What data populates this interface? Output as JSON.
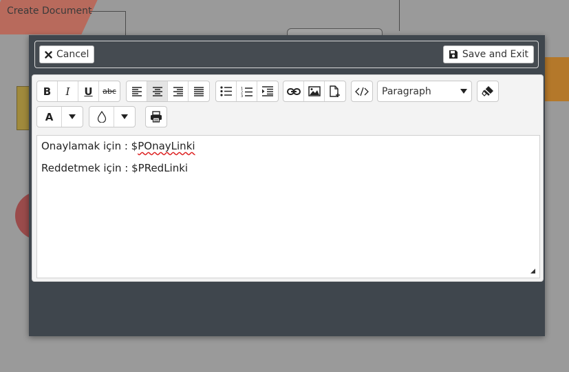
{
  "background": {
    "label": "Create Document"
  },
  "topbar": {
    "cancel_label": "Cancel",
    "save_label": "Save and Exit"
  },
  "toolbar": {
    "bold": "B",
    "italic": "I",
    "underline": "U",
    "strike": "abc",
    "font_color": "A",
    "paragraph_select": "Paragraph"
  },
  "content": {
    "line1_prefix": "Onaylamak için : $",
    "line1_var": "POnayLinki",
    "line2": "Reddetmek için : $PRedLinki"
  },
  "colors": {
    "modal_bg": "#3f464d",
    "editor_bg": "#f3f3f3"
  }
}
